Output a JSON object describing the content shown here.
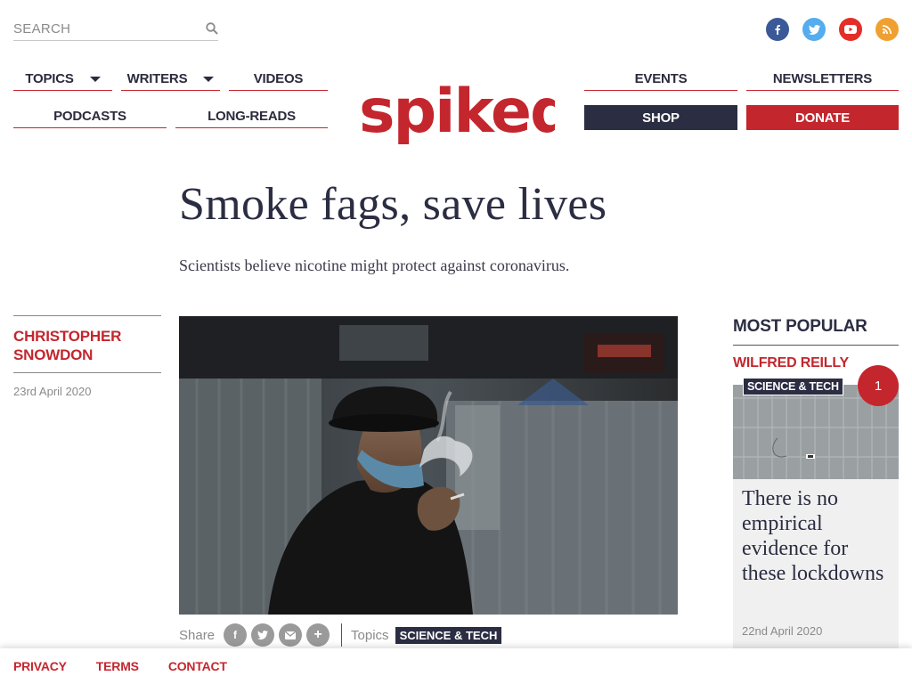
{
  "search": {
    "placeholder": "SEARCH"
  },
  "social": [
    {
      "name": "facebook",
      "color": "#3b5998",
      "glyph": "f"
    },
    {
      "name": "twitter",
      "color": "#55acee",
      "glyph": "t"
    },
    {
      "name": "youtube",
      "color": "#e52d27",
      "glyph": "▶"
    },
    {
      "name": "rss",
      "color": "#f0a030",
      "glyph": "r"
    }
  ],
  "nav": {
    "topics": "TOPICS",
    "writers": "WRITERS",
    "videos": "VIDEOS",
    "podcasts": "PODCASTS",
    "longreads": "LONG-READS",
    "events": "EVENTS",
    "newsletters": "NEWSLETTERS",
    "shop": "SHOP",
    "donate": "DONATE"
  },
  "brand": {
    "logo_text": "spiked",
    "color": "#c4262e"
  },
  "article": {
    "headline": "Smoke fags, save lives",
    "standfirst": "Scientists believe nicotine might protect against coronavirus.",
    "author_line1": "CHRISTOPHER",
    "author_line2": "SNOWDON",
    "date": "23rd April 2020",
    "share_label": "Share",
    "share_icons": [
      "facebook-icon",
      "twitter-icon",
      "email-icon",
      "plus-icon"
    ],
    "topics_label": "Topics",
    "topic": "SCIENCE & TECH"
  },
  "most_popular": {
    "title": "MOST POPULAR",
    "author": "WILFRED REILLY",
    "tag": "SCIENCE & TECH",
    "rank": "1",
    "headline": "There is no empirical evidence for these lockdowns",
    "date": "22nd April 2020"
  },
  "footer": {
    "privacy": "PRIVACY",
    "terms": "TERMS",
    "contact": "CONTACT"
  },
  "colors": {
    "accent": "#c4262e",
    "navy": "#2b2d42"
  }
}
